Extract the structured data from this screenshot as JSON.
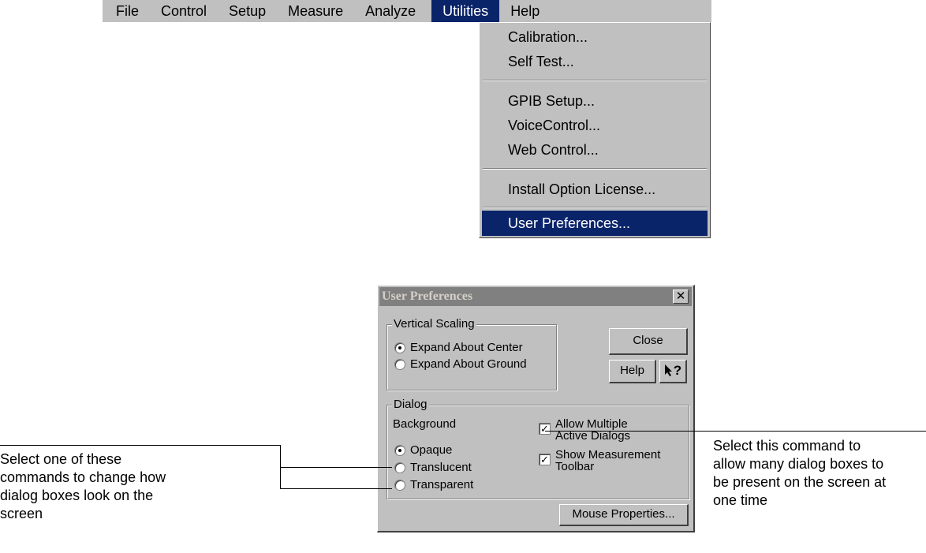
{
  "menubar": {
    "items": [
      "File",
      "Control",
      "Setup",
      "Measure",
      "Analyze",
      "Utilities",
      "Help"
    ],
    "active": "Utilities"
  },
  "dropdown": {
    "calibration": "Calibration...",
    "self_test": "Self Test...",
    "gpib_setup": "GPIB Setup...",
    "voice_control": "VoiceControl...",
    "web_control": "Web Control...",
    "install_option_license": "Install Option License...",
    "user_preferences": "User Preferences..."
  },
  "dialog": {
    "title": "User Preferences",
    "close_glyph": "✕",
    "vertical_scaling": {
      "label": "Vertical Scaling",
      "options": [
        "Expand About Center",
        "Expand About Ground"
      ],
      "selected": "Expand About Center"
    },
    "close_button": "Close",
    "help_button": "Help",
    "whats_this_glyph": "?",
    "dialog_group": {
      "label": "Dialog",
      "background_label": "Background",
      "background_options": [
        "Opaque",
        "Translucent",
        "Transparent"
      ],
      "selected": "Opaque",
      "allow_multiple_line1": "Allow Multiple",
      "allow_multiple_line2": "Active Dialogs",
      "allow_multiple_checked": true,
      "show_toolbar_line1": "Show Measurement",
      "show_toolbar_line2": "Toolbar",
      "show_toolbar_checked": true,
      "check_glyph": "✓"
    },
    "mouse_properties_button": "Mouse Properties..."
  },
  "callouts": {
    "left": [
      "Select one of these",
      "commands to change how",
      "dialog boxes look on the",
      "screen"
    ],
    "right": [
      "Select this command to",
      "allow many dialog boxes to",
      "be present on the screen at",
      "one time"
    ]
  },
  "colors": {
    "menu_highlight": "#0a246a",
    "face": "#c0c0c0",
    "titlebar_inactive": "#808080"
  }
}
